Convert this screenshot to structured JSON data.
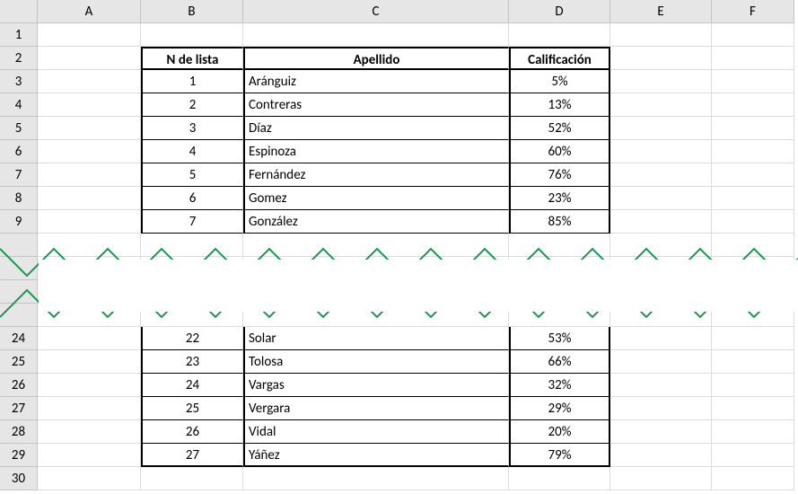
{
  "columns": [
    "A",
    "B",
    "C",
    "D",
    "E",
    "F"
  ],
  "rowNumbersTop": [
    "1",
    "2",
    "3",
    "4",
    "5",
    "6",
    "7",
    "8",
    "9"
  ],
  "rowNumbersBottom": [
    "24",
    "25",
    "26",
    "27",
    "28",
    "29",
    "30"
  ],
  "table": {
    "headers": {
      "b": "N de lista",
      "c": "Apellido",
      "d": "Calificación"
    },
    "rowsTop": [
      {
        "n": "1",
        "ap": "Aránguiz",
        "cal": "5%"
      },
      {
        "n": "2",
        "ap": "Contreras",
        "cal": "13%"
      },
      {
        "n": "3",
        "ap": "Díaz",
        "cal": "52%"
      },
      {
        "n": "4",
        "ap": "Espinoza",
        "cal": "60%"
      },
      {
        "n": "5",
        "ap": "Fernández",
        "cal": "76%"
      },
      {
        "n": "6",
        "ap": "Gomez",
        "cal": "23%"
      },
      {
        "n": "7",
        "ap": "González",
        "cal": "85%"
      }
    ],
    "rowsBottom": [
      {
        "n": "22",
        "ap": "Solar",
        "cal": "53%"
      },
      {
        "n": "23",
        "ap": "Tolosa",
        "cal": "66%"
      },
      {
        "n": "24",
        "ap": "Vargas",
        "cal": "32%"
      },
      {
        "n": "25",
        "ap": "Vergara",
        "cal": "29%"
      },
      {
        "n": "26",
        "ap": "Vidal",
        "cal": "20%"
      },
      {
        "n": "27",
        "ap": "Yáñez",
        "cal": "79%"
      }
    ]
  }
}
